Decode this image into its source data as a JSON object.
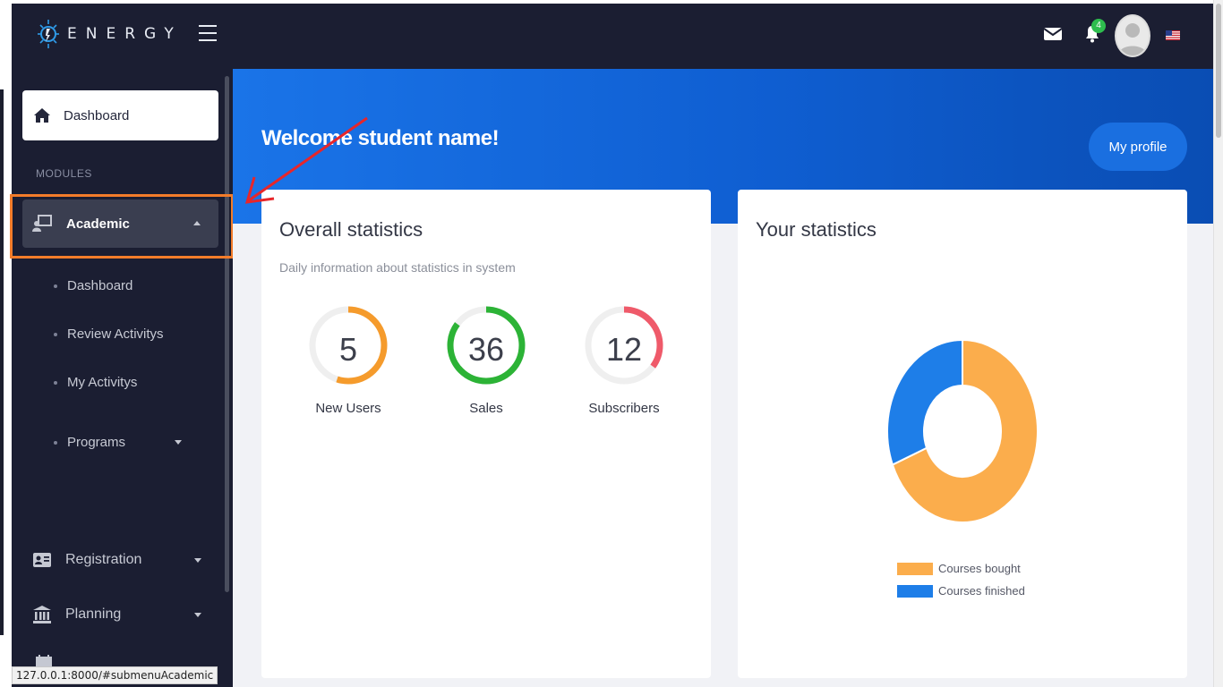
{
  "topbar": {
    "logo_text": "ENERGY",
    "notification_count": "4",
    "icons": [
      "menu-icon",
      "mail-icon",
      "bell-icon",
      "user-avatar",
      "us-flag-icon"
    ]
  },
  "sidebar": {
    "dashboard_label": "Dashboard",
    "section_label": "MODULES",
    "academic_label": "Academic",
    "academic_submenu": [
      {
        "label": "Dashboard"
      },
      {
        "label": "Review Activitys"
      },
      {
        "label": "My Activitys"
      },
      {
        "label": "Programs"
      }
    ],
    "items": [
      {
        "label": "Registration"
      },
      {
        "label": "Planning"
      }
    ]
  },
  "status_bar": {
    "url": "127.0.0.1:8000/#submenuAcademic"
  },
  "main": {
    "welcome": "Welcome student name!",
    "profile_button": "My profile",
    "overall": {
      "title": "Overall statistics",
      "subtitle": "Daily information about statistics in system",
      "gauges": [
        {
          "value": "5",
          "label": "New Users",
          "fraction": 0.55,
          "color": "#f59b2c"
        },
        {
          "value": "36",
          "label": "Sales",
          "fraction": 0.85,
          "color": "#2cb336"
        },
        {
          "value": "12",
          "label": "Subscribers",
          "fraction": 0.35,
          "color": "#ef5a6a"
        }
      ]
    },
    "yours": {
      "title": "Your statistics"
    }
  },
  "chart_data": {
    "type": "pie",
    "donut": true,
    "categories": [
      "Courses bought",
      "Courses finished"
    ],
    "values": [
      69,
      31
    ],
    "colors": [
      "#fbad4c",
      "#1e7ee8"
    ],
    "legend": "bottom"
  },
  "colors": {
    "topbar": "#1b1e32",
    "sidebar": "#1b1e32",
    "hero": "#1a74e8",
    "highlight": "#f37c2a",
    "annotation_arrow": "#e8262a"
  }
}
